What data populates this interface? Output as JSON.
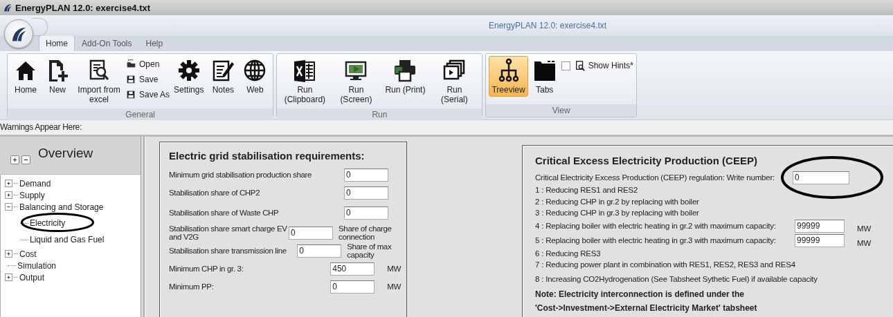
{
  "window": {
    "title": "EnergyPLAN 12.0: exercise4.txt",
    "caption": "EnergyPLAN 12.0: exercise4.txt"
  },
  "ribbon_tabs": [
    {
      "label": "Home",
      "selected": true
    },
    {
      "label": "Add-On Tools",
      "selected": false
    },
    {
      "label": "Help",
      "selected": false
    }
  ],
  "ribbon_groups": [
    {
      "label": "General",
      "items": [
        {
          "kind": "large",
          "label": "Home"
        },
        {
          "kind": "large",
          "label": "New"
        },
        {
          "kind": "large",
          "label": "Import from excel"
        },
        {
          "kind": "stack",
          "items": [
            {
              "label": "Open"
            },
            {
              "label": "Save"
            },
            {
              "label": "Save As"
            }
          ]
        },
        {
          "kind": "large",
          "label": "Settings"
        },
        {
          "kind": "large",
          "label": "Notes"
        },
        {
          "kind": "large",
          "label": "Web"
        }
      ]
    },
    {
      "label": "Run",
      "items": [
        {
          "kind": "large",
          "label": "Run (Clipboard)"
        },
        {
          "kind": "large",
          "label": "Run (Screen)"
        },
        {
          "kind": "large",
          "label": "Run (Print)"
        },
        {
          "kind": "large",
          "label": "Run (Serial)"
        }
      ]
    },
    {
      "label": "View",
      "items": [
        {
          "kind": "large",
          "label": "Treeview",
          "selected": true
        },
        {
          "kind": "large",
          "label": "Tabs",
          "selected": false
        },
        {
          "kind": "checkbox",
          "label": "Show Hints*",
          "checked": false
        }
      ]
    }
  ],
  "warnings": "Warnings Appear Here:",
  "sidebar": {
    "title": "Overview",
    "items": [
      {
        "label": "Demand",
        "expanded": false
      },
      {
        "label": "Supply",
        "expanded": false
      },
      {
        "label": "Balancing and Storage",
        "expanded": true,
        "children": [
          {
            "label": "Electricity"
          },
          {
            "label": "Liquid and Gas Fuel"
          }
        ]
      },
      {
        "label": "Cost",
        "expanded": false
      },
      {
        "label": "Simulation"
      },
      {
        "label": "Output",
        "expanded": false
      }
    ]
  },
  "grid_panel": {
    "title": "Electric grid stabilisation requirements:",
    "rows": [
      {
        "label": "Minimum grid stabilisation production share",
        "value": "0"
      },
      {
        "label": "Stabilisation share of CHP2",
        "value": "0"
      },
      {
        "label": "Stabilisation share of Waste CHP",
        "value": "0"
      },
      {
        "label": "Stabilisation share smart charge EV and V2G",
        "value": "0",
        "unit": "Share of charge connection"
      },
      {
        "label": "Stabilisation share transmission line",
        "value": "0",
        "unit": "Share of max capacity"
      },
      {
        "label": "Minimum CHP in gr. 3:",
        "value": "450",
        "unit": "MW"
      },
      {
        "label": "Minimum PP:",
        "value": "0",
        "unit": "MW"
      }
    ]
  },
  "ceep_panel": {
    "title": "Critical Excess Electricity Production (CEEP)",
    "prompt": "Critical Electricity Excess Production (CEEP) regulation: Write number:",
    "value": "0",
    "options": [
      {
        "text": "1 : Reducing RES1 and RES2"
      },
      {
        "text": "2 : Reducing CHP in gr.2 by replacing with boiler"
      },
      {
        "text": "3 : Reducing CHP in gr.3 by replacing with boiler"
      },
      {
        "text": "4 : Replacing boiler with electric heating in gr.2 with maximum capacity:",
        "value": "99999",
        "unit": "MW"
      },
      {
        "text": "5 : Replacing boiler with electric heating in gr.3 with maximum capacity:",
        "value": "99999",
        "unit": "MW"
      },
      {
        "text": "6 : Reducing RES3"
      },
      {
        "text": "7 : Reducing power plant in combination with RES1, RES2, RES3 and RES4"
      },
      {
        "text": "8 : Increasing CO2Hydrogenation (See Tabsheet Sythetic Fuel) if available capacity"
      }
    ],
    "note": [
      "Note: Electricity interconnection is defined under the",
      "'Cost->Investment->External Electricity Market' tabsheet"
    ]
  }
}
